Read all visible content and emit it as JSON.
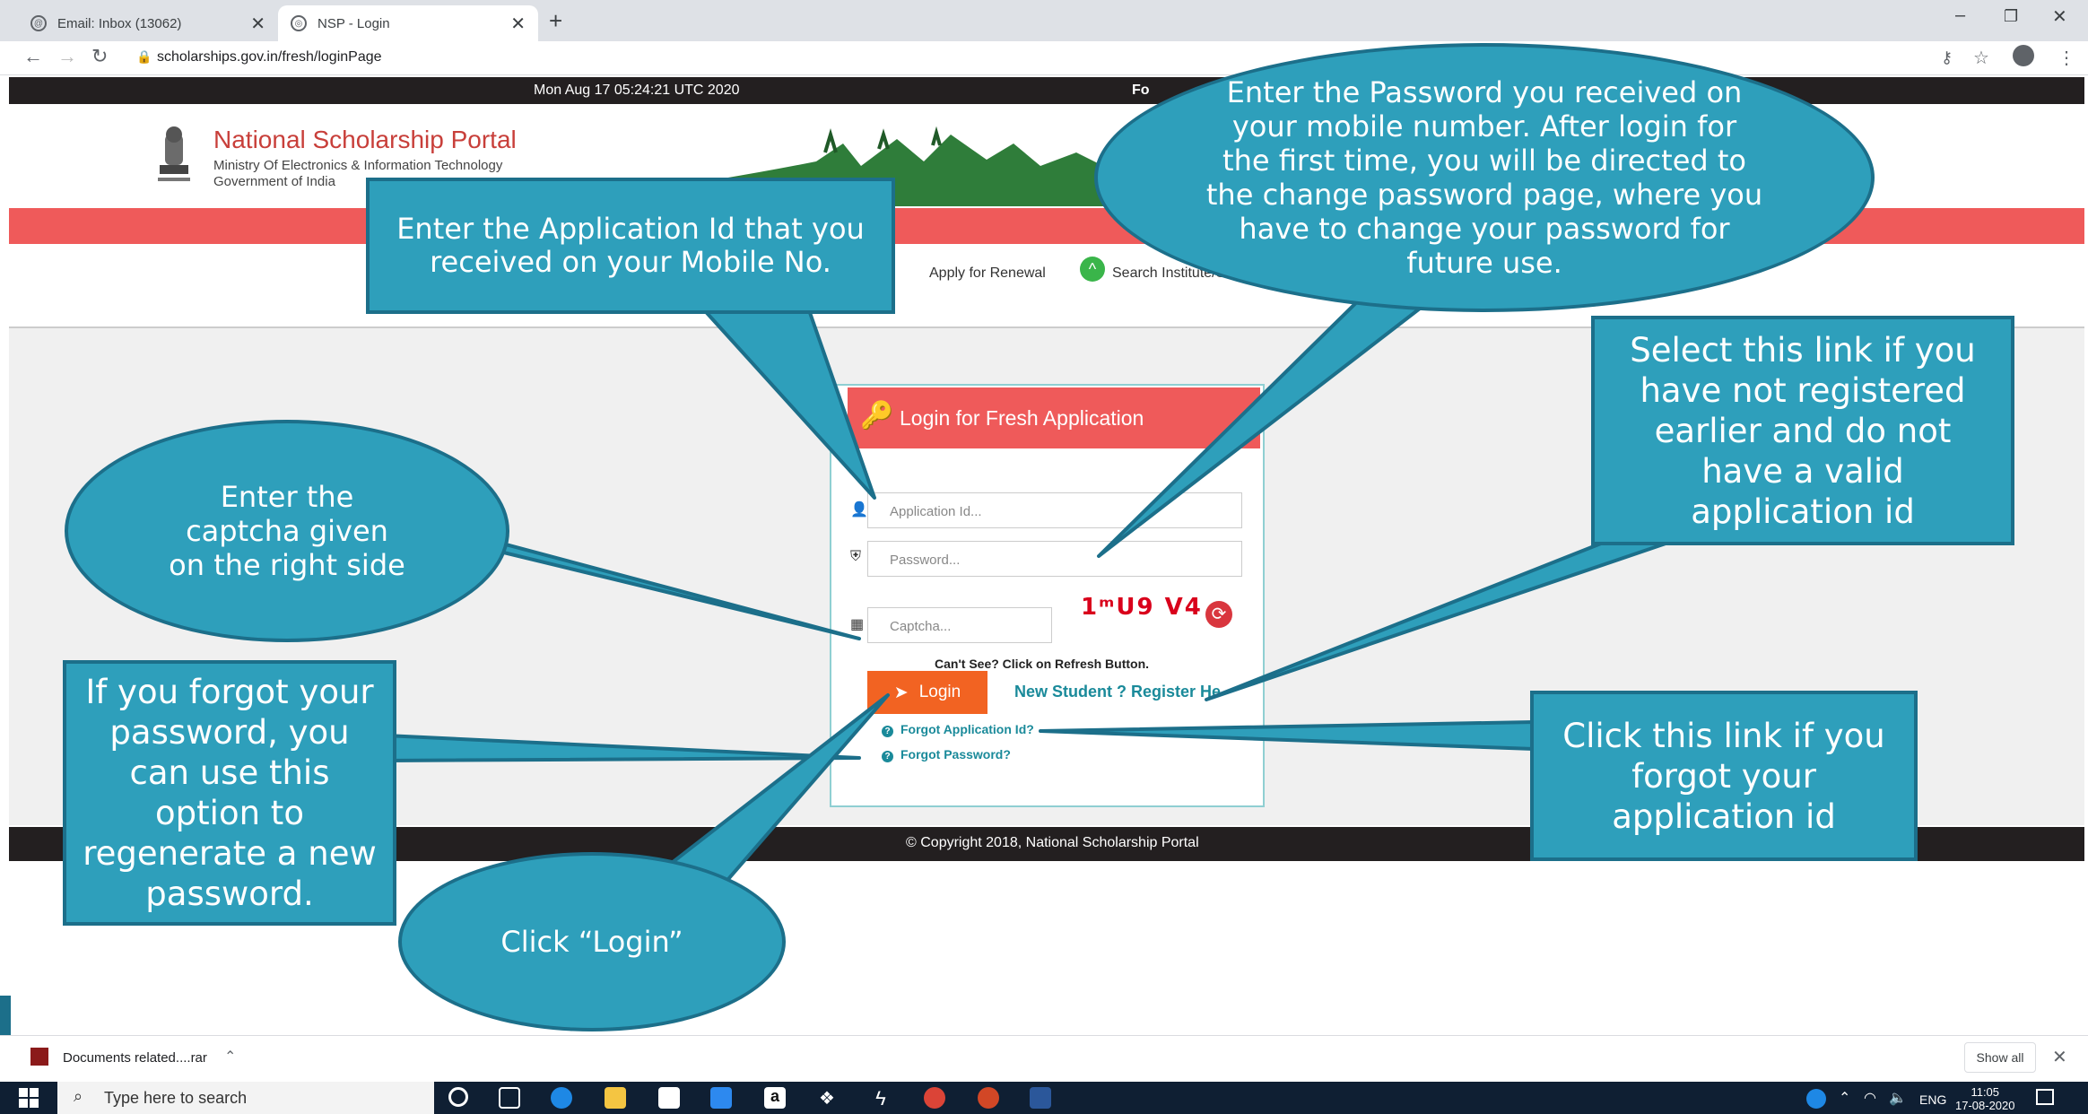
{
  "browser": {
    "tabs": [
      {
        "title": "Email: Inbox (13062)"
      },
      {
        "title": "NSP - Login"
      }
    ],
    "url": "scholarships.gov.in/fresh/loginPage"
  },
  "page": {
    "datetime": "Mon Aug 17 05:24:21 UTC 2020",
    "topbar_partial": "Fo",
    "portal_title": "National Scholarship Portal",
    "ministry": "Ministry Of Electronics & Information Technology",
    "government": "Government of India",
    "nav": {
      "renewal": "Apply for Renewal",
      "search": "Search Institute/Schoo"
    },
    "login_title": "Login for Fresh Application",
    "fields": {
      "application_id_placeholder": "Application Id...",
      "password_placeholder": "Password...",
      "captcha_placeholder": "Captcha..."
    },
    "captcha_text": "1ᵐU9 V4",
    "cant_see": "Can't See? Click on Refresh Button.",
    "login_button": "Login",
    "register_link": "New Student ? Register He",
    "forgot_app_id": "Forgot Application Id?",
    "forgot_password": "Forgot Password?",
    "copyright": "© Copyright 2018, National Scholarship Portal"
  },
  "callouts": {
    "application_id": "Enter the  Application Id that you received on your  Mobile No.",
    "password": "Enter the Password you received on your mobile number. After login for the first time, you will be directed to the change password page, where you have to change your password for future use.",
    "register": "Select this link if you have not registered earlier and do not have a valid application id",
    "captcha": "Enter the captcha given on the right side",
    "forgot_password": "If you forgot your password, you can use this option to regenerate a new password.",
    "forgot_app_id": "Click this link if you forgot your application id",
    "login": "Click “Login”"
  },
  "downloads": {
    "file": "Documents related....rar",
    "show_all": "Show all"
  },
  "taskbar": {
    "search_placeholder": "Type here to search",
    "lang": "ENG",
    "time": "11:05",
    "date": "17-08-2020"
  }
}
